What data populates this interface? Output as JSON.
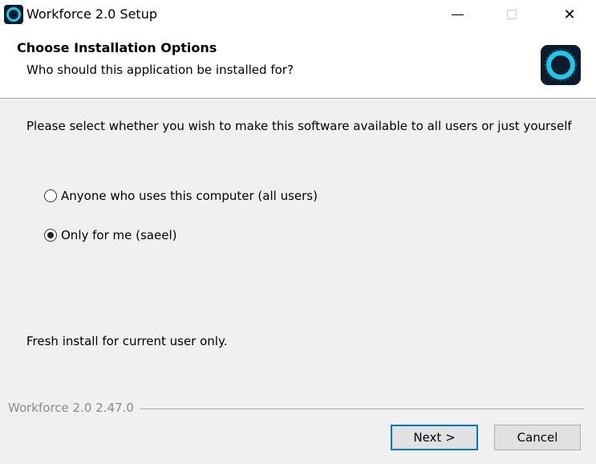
{
  "window": {
    "title": "Workforce 2.0 Setup",
    "controls": {
      "minimize": "minimize-icon",
      "maximize": "maximize-icon",
      "close": "close-icon",
      "close_glyph": "✕"
    }
  },
  "header": {
    "title": "Choose Installation Options",
    "subtitle": "Who should this application be installed for?",
    "logo_icon": "workforce-logo-icon"
  },
  "body": {
    "instruction": "Please select whether you wish to make this software available to all users or just yourself",
    "options": [
      {
        "label": "Anyone who uses this computer (all users)",
        "selected": false
      },
      {
        "label": "Only for me (saeel)",
        "selected": true
      }
    ],
    "status": "Fresh install for current user only."
  },
  "footer": {
    "branding": "Workforce 2.0 2.47.0",
    "next_label": "Next >",
    "cancel_label": "Cancel"
  },
  "colors": {
    "accent": "#0078d7",
    "logo_ring": "#1ec8e8",
    "logo_bg": "#0d1b2a",
    "dialog_bg": "#f0f0f0"
  }
}
